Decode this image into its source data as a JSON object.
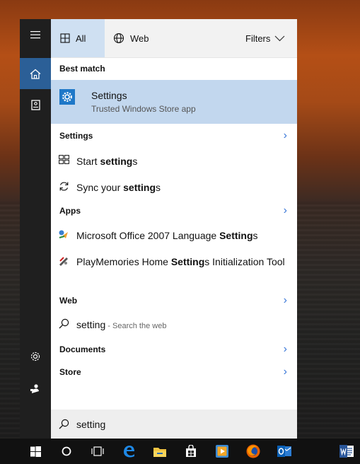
{
  "colors": {
    "accent": "#2b5f97",
    "best_match_bg": "#c2d7ee",
    "chevron": "#3b78d8"
  },
  "tabs": {
    "all": "All",
    "web": "Web",
    "filters": "Filters"
  },
  "best_match": {
    "heading": "Best match",
    "title": "Settings",
    "subtitle": "Trusted Windows Store app"
  },
  "sections": {
    "settings": "Settings",
    "apps": "Apps",
    "web": "Web",
    "documents": "Documents",
    "store": "Store"
  },
  "settings_results": [
    {
      "prefix": "Start ",
      "bold": "setting",
      "suffix": "s",
      "icon": "start-settings-icon"
    },
    {
      "prefix": "Sync your ",
      "bold": "setting",
      "suffix": "s",
      "icon": "sync-icon"
    }
  ],
  "app_results": [
    {
      "prefix": "Microsoft Office 2007 Language ",
      "bold": "Setting",
      "suffix": "s",
      "icon": "office-language-icon"
    },
    {
      "prefix": "PlayMemories Home ",
      "bold": "Setting",
      "suffix": "s Initialization Tool",
      "icon": "playmemories-icon"
    }
  ],
  "web_result": {
    "query": "setting",
    "hint": " - Search the web"
  },
  "search": {
    "value": "setting"
  },
  "rail": [
    "menu-icon",
    "home-icon",
    "notebook-icon",
    "settings-gear-icon",
    "feedback-icon"
  ],
  "taskbar": [
    "windows-start-icon",
    "cortana-circle-icon",
    "task-view-icon",
    "edge-icon",
    "file-explorer-icon",
    "store-icon",
    "media-player-icon",
    "firefox-icon",
    "outlook-icon",
    "word-icon"
  ]
}
